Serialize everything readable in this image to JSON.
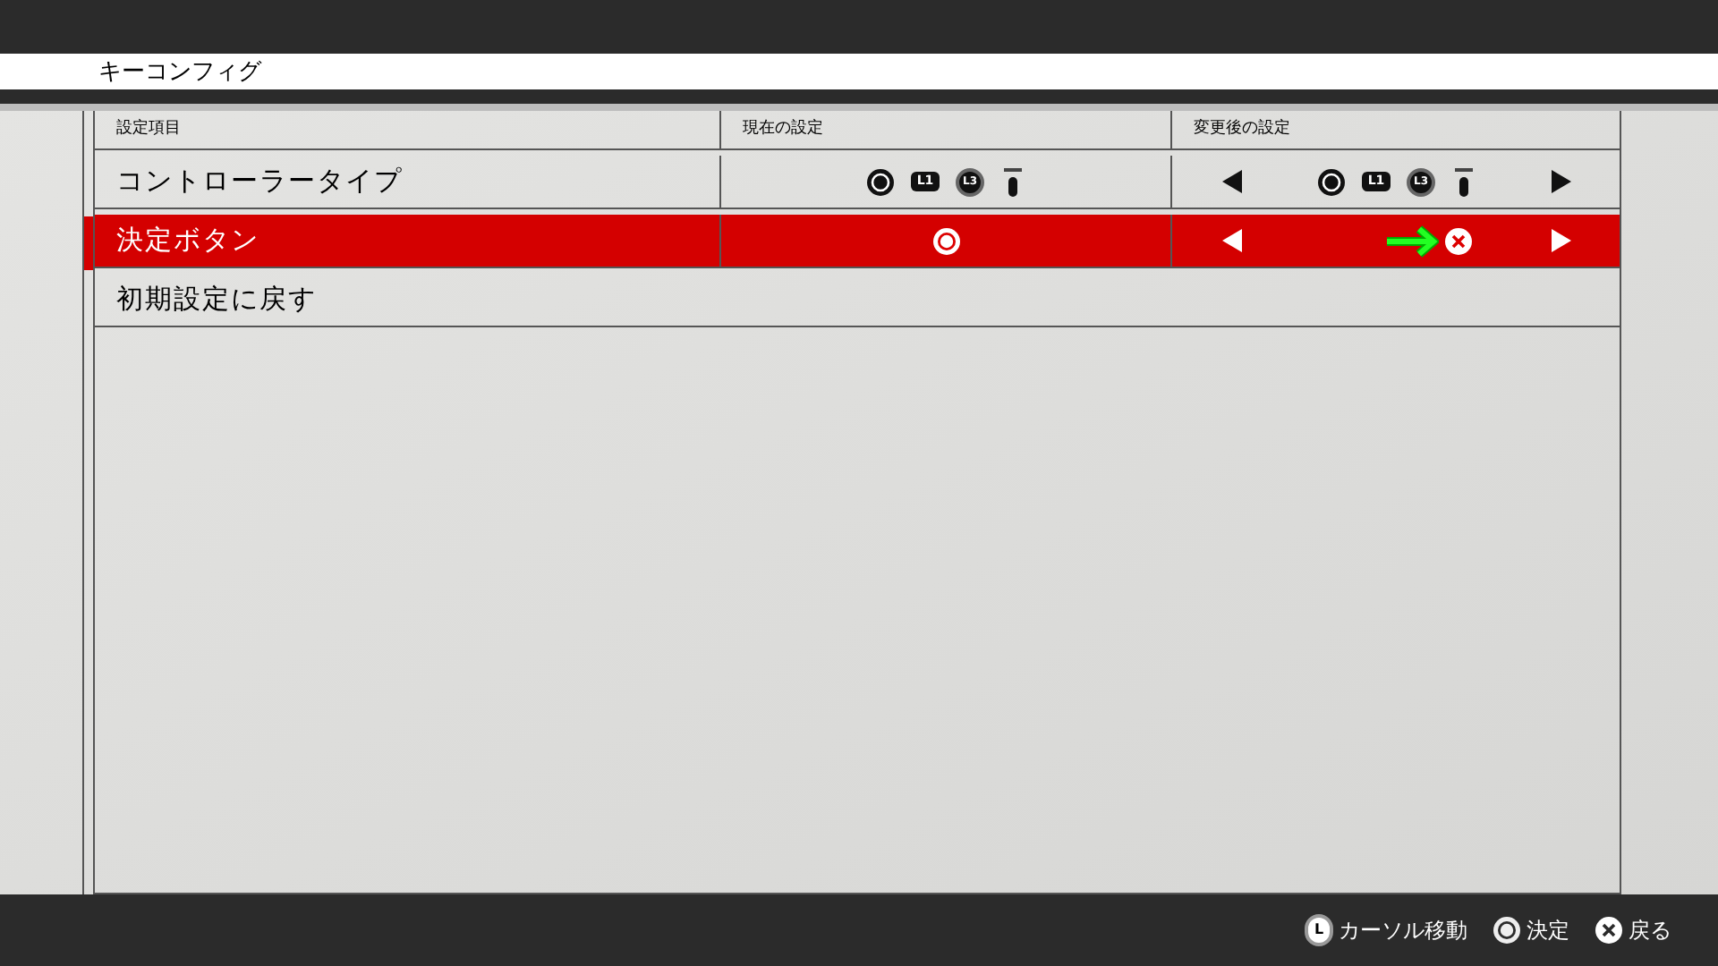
{
  "title": "キーコンフィグ",
  "table": {
    "columns": [
      "設定項目",
      "現在の設定",
      "変更後の設定"
    ],
    "rows": [
      {
        "label": "コントローラータイプ",
        "selected": false,
        "current": [
          {
            "kind": "circle-button"
          },
          {
            "kind": "l1",
            "label": "L1"
          },
          {
            "kind": "l3",
            "label": "L3"
          },
          {
            "kind": "options"
          }
        ],
        "new": {
          "pointer": false,
          "buttons": [
            {
              "kind": "circle-button"
            },
            {
              "kind": "l1",
              "label": "L1"
            },
            {
              "kind": "l3",
              "label": "L3"
            },
            {
              "kind": "options"
            }
          ]
        }
      },
      {
        "label": "決定ボタン",
        "selected": true,
        "current": [
          {
            "kind": "ring"
          }
        ],
        "new": {
          "pointer": true,
          "buttons": [
            {
              "kind": "cross"
            }
          ]
        }
      },
      {
        "label": "初期設定に戻す",
        "selected": false
      }
    ]
  },
  "footer": [
    {
      "kind": "stick",
      "icon_label": "L",
      "text": "カーソル移動"
    },
    {
      "kind": "ring",
      "text": "決定"
    },
    {
      "kind": "cross",
      "text": "戻る"
    }
  ]
}
